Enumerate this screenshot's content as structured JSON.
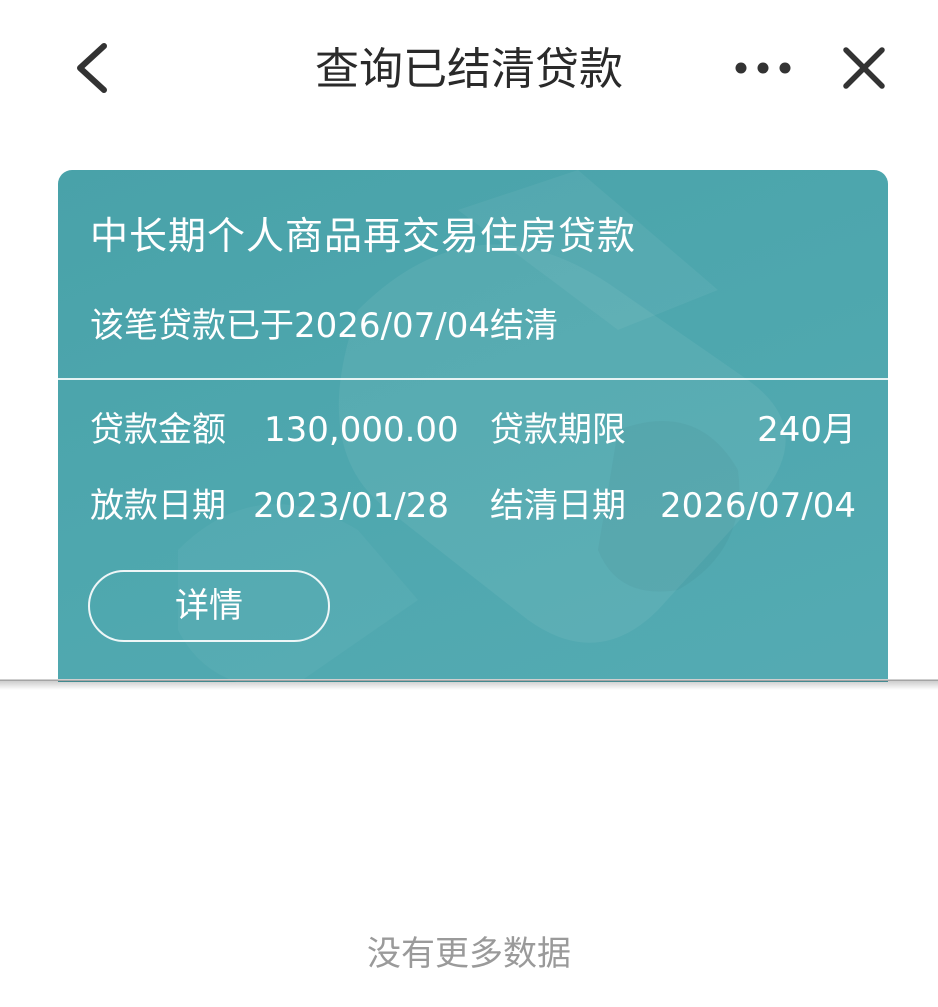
{
  "header": {
    "title": "查询已结清贷款",
    "back_icon": "chevron-left-icon",
    "more_icon": "more-dots-icon",
    "close_icon": "close-icon"
  },
  "loan_card": {
    "product_name": "中长期个人商品再交易住房贷款",
    "status_text": "该笔贷款已于2026/07/04结清",
    "fields": {
      "amount_label": "贷款金额",
      "amount_value": "130,000.00",
      "term_label": "贷款期限",
      "term_value": "240月",
      "release_date_label": "放款日期",
      "release_date_value": "2023/01/28",
      "settle_date_label": "结清日期",
      "settle_date_value": "2026/07/04"
    },
    "detail_button_label": "详情",
    "colors": {
      "card_background": "#4ea7ae",
      "text": "#ffffff"
    }
  },
  "footer": {
    "no_more_text": "没有更多数据"
  }
}
